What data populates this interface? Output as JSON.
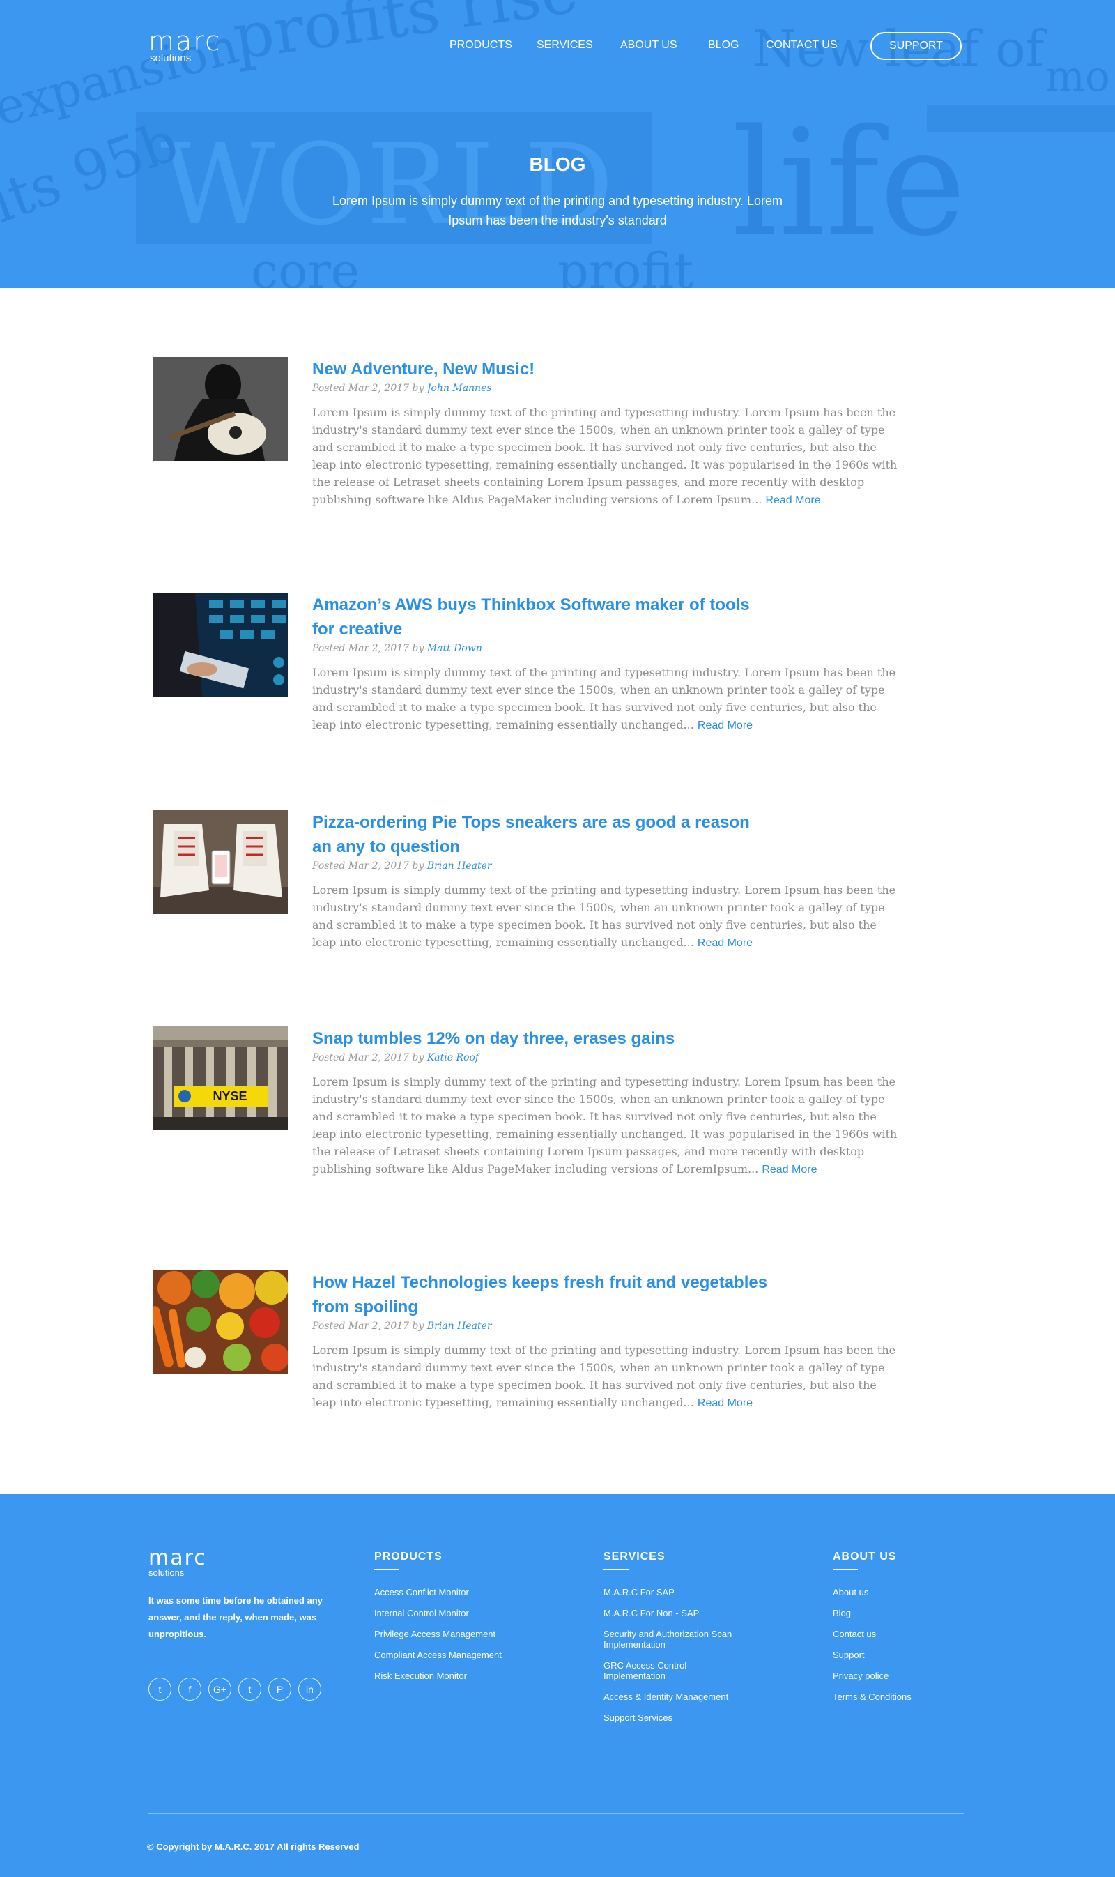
{
  "brand": {
    "name": "marc",
    "tagline": "solutions",
    "accent": "#2a8fe6",
    "hero_bg": "#3c97f1"
  },
  "nav": {
    "items": [
      "PRODUCTS",
      "SERVICES",
      "ABOUT US",
      "BLOG",
      "CONTACT US"
    ],
    "support": "SUPPORT"
  },
  "hero": {
    "title": "BLOG",
    "subtitle": "Lorem Ipsum is simply dummy text of the printing and typesetting industry. Lorem Ipsum has been the industry's standard"
  },
  "posts": [
    {
      "title": "New Adventure, New Music!",
      "posted": "Posted Mar 2, 2017 by",
      "author": "John Mannes",
      "excerpt": "Lorem Ipsum is simply dummy text of the printing and typesetting industry. Lorem Ipsum has been the industry's standard dummy text ever since the 1500s, when an unknown printer took a galley of type and scrambled it to make a type specimen book. It has survived not only five centuries, but also the leap into electronic typesetting, remaining essentially unchanged. It was popularised in the 1960s with the release of Letraset sheets containing Lorem Ipsum passages, and more recently with desktop publishing software like Aldus PageMaker including versions of Lorem Ipsum...",
      "read_more": "Read More",
      "image": "guitar-photo"
    },
    {
      "title": "Amazon’s AWS buys Thinkbox Software maker of tools for creative",
      "posted": "Posted Mar 2, 2017 by",
      "author": "Matt Down",
      "excerpt": "Lorem Ipsum is simply dummy text of the printing and typesetting industry. Lorem Ipsum has been the industry's standard dummy text ever since the 1500s, when an unknown printer took a galley of type and scrambled it to make a type specimen book. It has survived not only five centuries, but also the leap into electronic typesetting, remaining essentially unchanged...",
      "read_more": "Read More",
      "image": "tech-tablet-photo"
    },
    {
      "title": "Pizza-ordering Pie Tops sneakers are as good a reason an any to question",
      "posted": "Posted Mar 2, 2017 by",
      "author": "Brian Heater",
      "excerpt": "Lorem Ipsum is simply dummy text of the printing and typesetting industry. Lorem Ipsum has been the industry's standard dummy text ever since the 1500s, when an unknown printer took a galley of type and scrambled it to make a type specimen book. It has survived not only five centuries, but also the leap into electronic typesetting, remaining essentially unchanged...",
      "read_more": "Read More",
      "image": "sneakers-photo"
    },
    {
      "title": "Snap tumbles 12% on day three, erases gains",
      "posted": "Posted Mar 2, 2017 by",
      "author": "Katie Roof",
      "excerpt": "Lorem Ipsum is simply dummy text of the printing and typesetting industry. Lorem Ipsum has been the industry's standard dummy text ever since the 1500s, when an unknown printer took a galley of type and scrambled it to make a type specimen book. It has survived not only five centuries, but also the leap into electronic typesetting, remaining essentially unchanged. It was popularised in the 1960s with the release of Letraset sheets containing Lorem Ipsum passages, and more recently with desktop publishing software like Aldus PageMaker including versions of LoremIpsum...",
      "read_more": "Read More",
      "image": "nyse-photo",
      "image_text": "NYSE"
    },
    {
      "title": "How Hazel Technologies keeps fresh fruit and vegetables from spoiling",
      "posted": "Posted Mar 2, 2017 by",
      "author": "Brian Heater",
      "excerpt": "Lorem Ipsum is simply dummy text of the printing and typesetting industry. Lorem Ipsum has been the industry's standard dummy text ever since the 1500s, when an unknown printer took a galley of type and scrambled it to make a type specimen book. It has survived not only five centuries, but also the leap into electronic typesetting, remaining essentially unchanged...",
      "read_more": "Read More",
      "image": "vegetables-photo"
    }
  ],
  "footer": {
    "about": "It was some time before he obtained any answer, and the reply, when made, was unpropitious.",
    "socials": [
      "twitter-icon",
      "facebook-icon",
      "google-plus-icon",
      "tumblr-icon",
      "pinterest-icon",
      "linkedin-icon"
    ],
    "social_glyphs": [
      "t",
      "f",
      "G+",
      "t",
      "P",
      "in"
    ],
    "columns": [
      {
        "title": "PRODUCTS",
        "links": [
          "Access Conflict Monitor",
          "Internal Control Monitor",
          "Privilege Access Management",
          "Compliant Access Management",
          "Risk Execution Monitor"
        ]
      },
      {
        "title": "SERVICES",
        "links": [
          "M.A.R.C For SAP",
          "M.A.R.C For Non - SAP",
          "Security and Authorization Scan Implementation",
          "GRC Access Control Implementation",
          "Access & Identity Management",
          "Support Services"
        ]
      },
      {
        "title": "ABOUT US",
        "links": [
          "About us",
          "Blog",
          "Contact us",
          "Support",
          "Privacy police",
          "Terms & Conditions"
        ]
      }
    ],
    "copyright": "© Copyright by M.A.R.C. 2017 All rights Reserved"
  }
}
